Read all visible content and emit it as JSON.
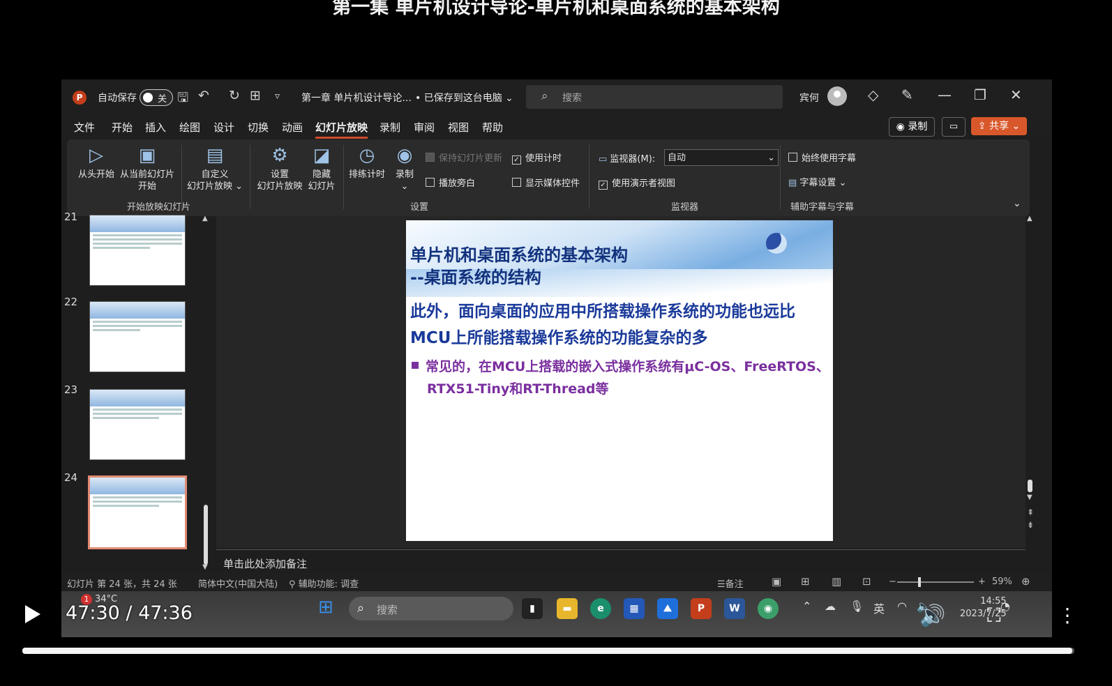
{
  "video": {
    "title": "第一集 单片机设计导论-单片机和桌面系统的基本架构",
    "time": "47:30 / 47:36",
    "progress": 0.998
  },
  "titlebar": {
    "app_icon": "P",
    "autosave_label": "自动保存",
    "autosave_state": "关",
    "doc_title": "第一章 单片机设计导论...",
    "saved_status": "• 已保存到这台电脑 ⌄",
    "search_placeholder": "搜索",
    "user_name": "宾何"
  },
  "menu": {
    "items": [
      "文件",
      "开始",
      "插入",
      "绘图",
      "设计",
      "切换",
      "动画",
      "幻灯片放映",
      "录制",
      "审阅",
      "视图",
      "帮助"
    ],
    "active_index": 7,
    "record_button": "◉ 录制",
    "share_button": "⇪ 共享 ⌄"
  },
  "ribbon": {
    "from_start": "从头开始",
    "from_current_1": "从当前幻灯片",
    "from_current_2": "开始",
    "custom_1": "自定义",
    "custom_2": "幻灯片放映 ⌄",
    "group1_label": "开始放映幻灯片",
    "setup_1": "设置",
    "setup_2": "幻灯片放映",
    "hide_1": "隐藏",
    "hide_2": "幻灯片",
    "rehearse": "排练计时",
    "record_1": "录制",
    "record_2": "⌄",
    "keep_updated": "保持幻灯片更新",
    "use_timings": "使用计时",
    "play_narrations": "播放旁白",
    "show_media_controls": "显示媒体控件",
    "group2_label": "设置",
    "monitor_label": "监视器(M):",
    "monitor_value": "自动",
    "presenter_view": "使用演示者视图",
    "group3_label": "监视器",
    "always_subtitles": "始终使用字幕",
    "subtitle_settings": "字幕设置 ⌄",
    "group4_label": "辅助字幕与字幕"
  },
  "thumbnails": [
    {
      "num": "21"
    },
    {
      "num": "22"
    },
    {
      "num": "23"
    },
    {
      "num": "24"
    }
  ],
  "slide": {
    "title_line1": "单片机和桌面系统的基本架构",
    "title_line2": "--桌面系统的结构",
    "para_line1": "此外，面向桌面的应用中所搭载操作系统的功能也远比",
    "para_line2": "MCU上所能搭载操作系统的功能复杂的多",
    "bullet_line1": "常见的，在MCU上搭载的嵌入式操作系统有μC-OS、FreeRTOS、",
    "bullet_line2": "RTX51-Tiny和RT-Thread等"
  },
  "notes_placeholder": "单击此处添加备注",
  "status": {
    "slide_count": "幻灯片 第 24 张，共 24 张",
    "language": "简体中文(中国大陆)",
    "accessibility": "辅助功能: 调查",
    "notes": "备注",
    "zoom": "59%"
  },
  "taskbar": {
    "weather_badge": "1",
    "temperature": "34°C",
    "search_placeholder": "搜索",
    "ime": "英",
    "clock_time": "14:55",
    "clock_date": "2023/7/25"
  },
  "colors": {
    "accent": "#d04a2c",
    "share": "#d9582b",
    "slide_title": "#12327e",
    "slide_bullet": "#7a2f9e"
  }
}
